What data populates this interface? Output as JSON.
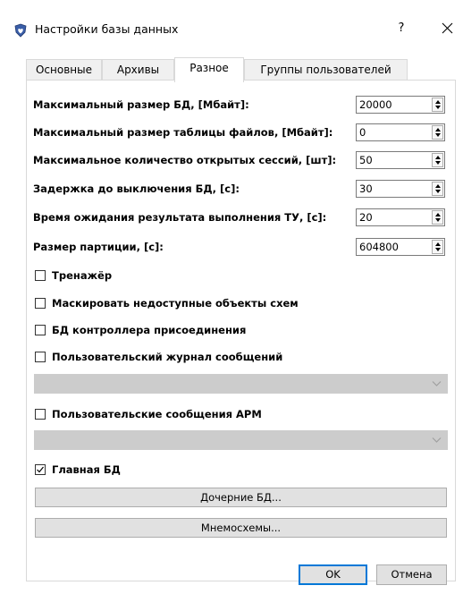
{
  "window": {
    "title": "Настройки базы данных",
    "help": "?",
    "icon": "shield-heart-icon"
  },
  "tabs": [
    {
      "label": "Основные",
      "active": false
    },
    {
      "label": "Архивы",
      "active": false
    },
    {
      "label": "Разное",
      "active": true
    },
    {
      "label": "Группы пользователей",
      "active": false
    }
  ],
  "fields": [
    {
      "label": "Максимальный размер БД, [Мбайт]:",
      "value": "20000"
    },
    {
      "label": "Максимальный размер таблицы файлов, [Мбайт]:",
      "value": "0"
    },
    {
      "label": "Максимальное количество открытых сессий, [шт]:",
      "value": "50"
    },
    {
      "label": "Задержка до выключения БД, [с]:",
      "value": "30"
    },
    {
      "label": "Время ожидания результата выполнения ТУ, [с]:",
      "value": "20"
    },
    {
      "label": "Размер партиции, [с]:",
      "value": "604800"
    }
  ],
  "checkboxes": {
    "trainer": {
      "label": "Тренажёр",
      "checked": false
    },
    "mask": {
      "label": "Маскировать недоступные объекты схем",
      "checked": false
    },
    "controller_db": {
      "label": "БД контроллера присоединения",
      "checked": false
    },
    "user_journal": {
      "label": "Пользовательский журнал сообщений",
      "checked": false
    },
    "arm_messages": {
      "label": "Пользовательские сообщения АРМ",
      "checked": false
    },
    "main_db": {
      "label": "Главная БД",
      "checked": true
    }
  },
  "combos": {
    "journal": {
      "value": "",
      "enabled": false
    },
    "arm": {
      "value": "",
      "enabled": false
    }
  },
  "buttons": {
    "child_db": "Дочерние БД...",
    "mnemo": "Мнемосхемы...",
    "ok": "OK",
    "cancel": "Отмена"
  },
  "colors": {
    "accent": "#0078d7",
    "disabled_combo": "#cccccc",
    "button_face": "#e1e1e1"
  }
}
